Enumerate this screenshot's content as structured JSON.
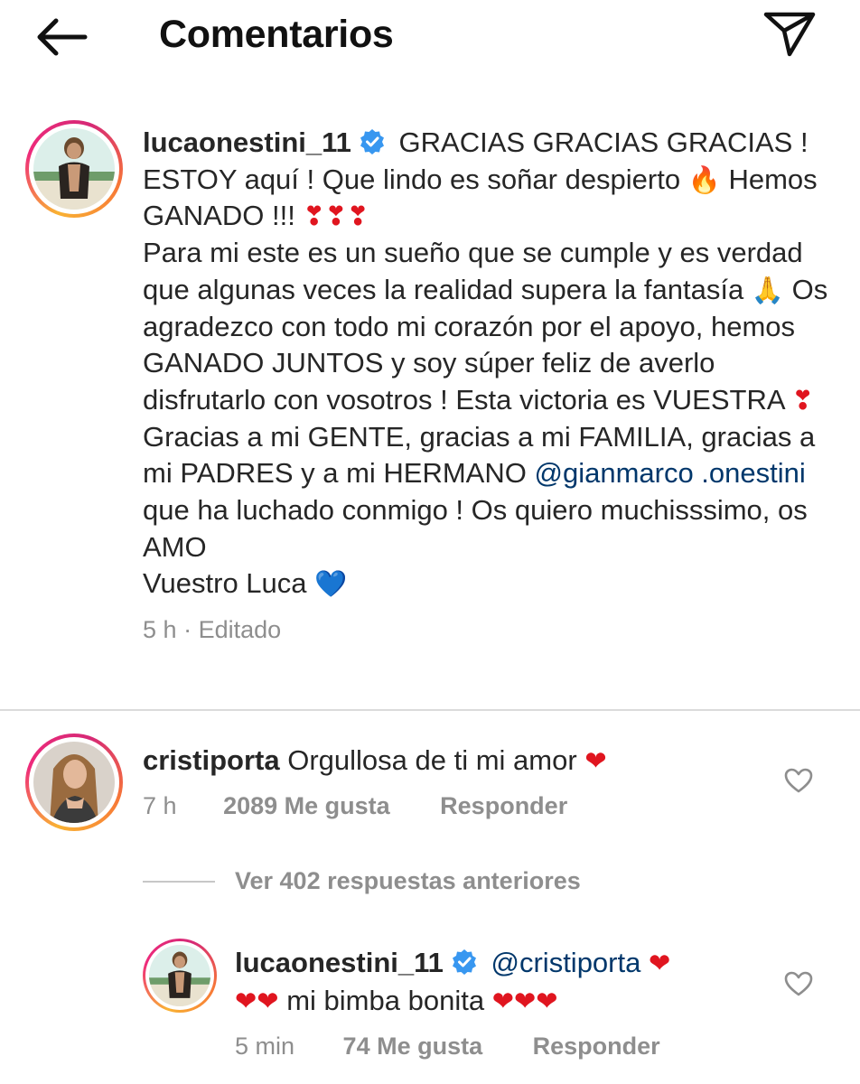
{
  "header": {
    "title": "Comentarios"
  },
  "post": {
    "username": "lucaonestini_11",
    "text_1": "GRACIAS GRACIAS GRACIAS ! ESTOY aquí ! Que lindo es soñar despierto",
    "emoji_fire": "🔥",
    "text_2": "Hemos GANADO !!!",
    "emoji_hearts_ex": "❣❣❣",
    "text_3": "Para mi este es un sueño que se cumple y es verdad que algunas veces la realidad supera la fantasía",
    "emoji_pray": "🙏",
    "text_4": "Os agradezco con todo mi corazón por el apoyo, hemos GANADO JUNTOS y soy súper feliz de averlo disfrutarlo con vosotros ! Esta victoria es VUESTRA",
    "emoji_heart_ex": "❣",
    "text_5": "Gracias a mi GENTE, gracias a mi FAMILIA, gracias a mi PADRES y a mi HERMANO",
    "mention": "@gianmarco .onestini",
    "text_6": "que ha luchado conmigo ! Os quiero muchisssimo, os AMO",
    "text_7": "Vuestro Luca",
    "emoji_blue_heart": "💙",
    "time": "5 h",
    "separator": "·",
    "edited": "Editado"
  },
  "comments": [
    {
      "username": "cristiporta",
      "text": "Orgullosa de ti mi amor",
      "emoji": "❤",
      "time": "7 h",
      "likes": "2089 Me gusta",
      "reply": "Responder"
    }
  ],
  "view_replies": "Ver 402 respuestas anteriores",
  "reply": {
    "username": "lucaonestini_11",
    "mention": "@cristiporta",
    "emoji_a": "❤",
    "emoji_b": "❤❤",
    "text": "mi bimba bonita",
    "emoji_c": "❤❤❤",
    "time": "5 min",
    "likes": "74 Me gusta",
    "reply": "Responder"
  },
  "colors": {
    "link": "#00376b",
    "muted": "#8e8e8e",
    "verified": "#3897f0",
    "heart": "#e0151f"
  },
  "icons": [
    "back-arrow-icon",
    "direct-send-icon",
    "verified-badge-icon",
    "heart-outline-icon"
  ]
}
